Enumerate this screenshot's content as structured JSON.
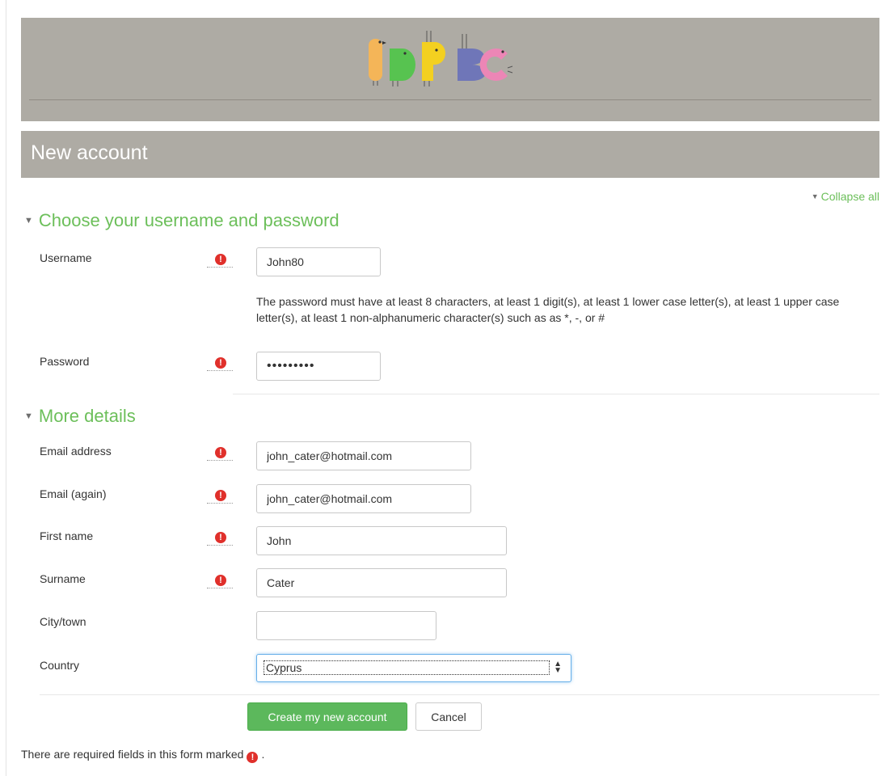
{
  "header": {
    "logo_name": "ippbc-logo",
    "title": "New account"
  },
  "collapse_all": "Collapse all",
  "sections": {
    "credentials": {
      "legend": "Choose your username and password",
      "username": {
        "label": "Username",
        "value": "John80"
      },
      "password_policy": "The password must have at least 8 characters, at least 1 digit(s), at least 1 lower case letter(s), at least 1 upper case letter(s), at least 1 non-alphanumeric character(s) such as as *, -, or #",
      "password": {
        "label": "Password",
        "value": "•••••••••"
      }
    },
    "details": {
      "legend": "More details",
      "email": {
        "label": "Email address",
        "value": "john_cater@hotmail.com"
      },
      "email2": {
        "label": "Email (again)",
        "value": "john_cater@hotmail.com"
      },
      "firstname": {
        "label": "First name",
        "value": "John"
      },
      "surname": {
        "label": "Surname",
        "value": "Cater"
      },
      "city": {
        "label": "City/town",
        "value": ""
      },
      "country": {
        "label": "Country",
        "value": "Cyprus"
      }
    }
  },
  "buttons": {
    "submit": "Create my new account",
    "cancel": "Cancel"
  },
  "footnote": {
    "text": "There are required fields in this form marked",
    "end": "."
  },
  "colors": {
    "accent_green": "#6cbf5a",
    "banner_gray": "#aeaba4",
    "required_red": "#e0302b",
    "button_green": "#5cb85c"
  },
  "icons": {
    "required": "exclamation-circle-icon",
    "collapse": "triangle-down-icon",
    "select_caret": "up-down-caret-icon"
  }
}
